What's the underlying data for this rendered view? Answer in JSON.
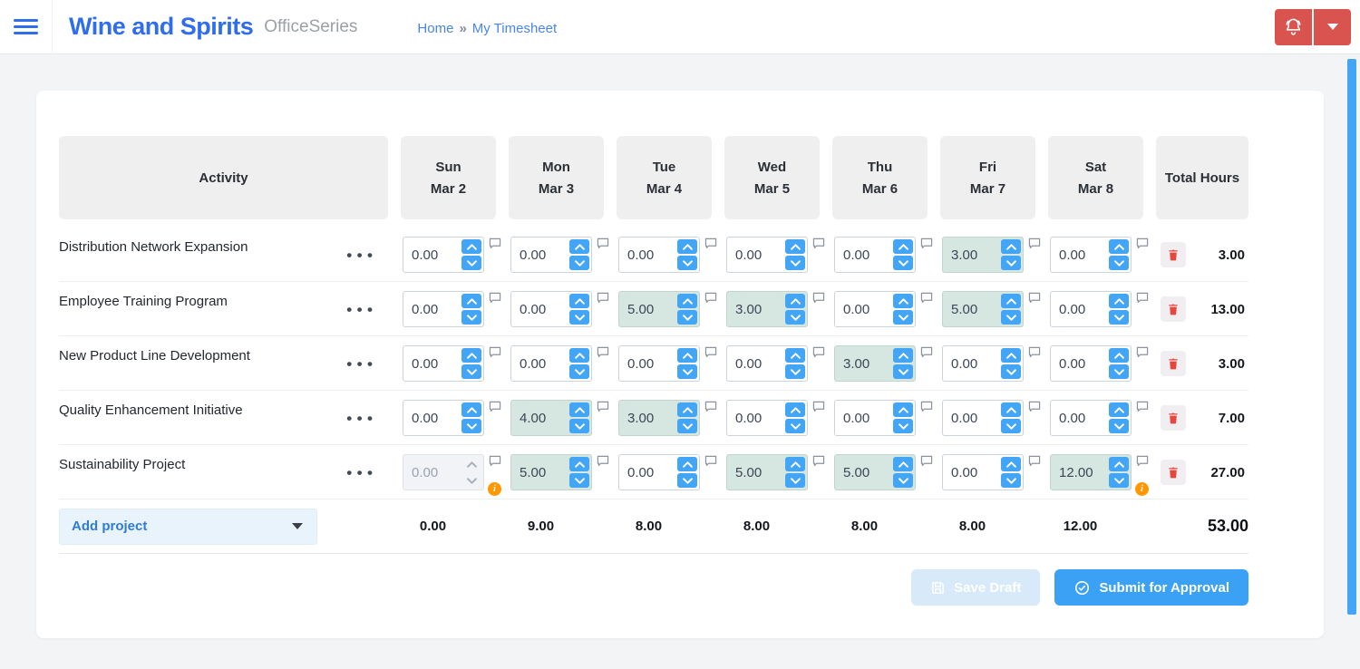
{
  "header": {
    "app_title": "Wine and Spirits",
    "app_subtitle": "OfficeSeries",
    "breadcrumb": {
      "home": "Home",
      "separator": "»",
      "current": "My Timesheet"
    }
  },
  "timesheet": {
    "activity_header": "Activity",
    "total_header": "Total Hours",
    "days": [
      {
        "name": "Sun",
        "date": "Mar 2"
      },
      {
        "name": "Mon",
        "date": "Mar 3"
      },
      {
        "name": "Tue",
        "date": "Mar 4"
      },
      {
        "name": "Wed",
        "date": "Mar 5"
      },
      {
        "name": "Thu",
        "date": "Mar 6"
      },
      {
        "name": "Fri",
        "date": "Mar 7"
      },
      {
        "name": "Sat",
        "date": "Mar 8"
      }
    ],
    "rows": [
      {
        "activity": "Distribution Network Expansion",
        "cells": [
          {
            "value": "0.00"
          },
          {
            "value": "0.00"
          },
          {
            "value": "0.00"
          },
          {
            "value": "0.00"
          },
          {
            "value": "0.00"
          },
          {
            "value": "3.00",
            "highlighted": true
          },
          {
            "value": "0.00"
          }
        ],
        "total": "3.00"
      },
      {
        "activity": "Employee Training Program",
        "cells": [
          {
            "value": "0.00"
          },
          {
            "value": "0.00"
          },
          {
            "value": "5.00",
            "highlighted": true
          },
          {
            "value": "3.00",
            "highlighted": true
          },
          {
            "value": "0.00"
          },
          {
            "value": "5.00",
            "highlighted": true
          },
          {
            "value": "0.00"
          }
        ],
        "total": "13.00"
      },
      {
        "activity": "New Product Line Development",
        "cells": [
          {
            "value": "0.00"
          },
          {
            "value": "0.00"
          },
          {
            "value": "0.00"
          },
          {
            "value": "0.00"
          },
          {
            "value": "3.00",
            "highlighted": true
          },
          {
            "value": "0.00"
          },
          {
            "value": "0.00"
          }
        ],
        "total": "3.00"
      },
      {
        "activity": "Quality Enhancement Initiative",
        "cells": [
          {
            "value": "0.00"
          },
          {
            "value": "4.00",
            "highlighted": true
          },
          {
            "value": "3.00",
            "highlighted": true
          },
          {
            "value": "0.00"
          },
          {
            "value": "0.00"
          },
          {
            "value": "0.00"
          },
          {
            "value": "0.00"
          }
        ],
        "total": "7.00"
      },
      {
        "activity": "Sustainability Project",
        "cells": [
          {
            "value": "0.00",
            "disabled": true,
            "warning": true
          },
          {
            "value": "5.00",
            "highlighted": true
          },
          {
            "value": "0.00"
          },
          {
            "value": "5.00",
            "highlighted": true
          },
          {
            "value": "5.00",
            "highlighted": true
          },
          {
            "value": "0.00"
          },
          {
            "value": "12.00",
            "highlighted": true,
            "warning": true
          }
        ],
        "total": "27.00"
      }
    ],
    "footer": {
      "add_project_label": "Add project",
      "day_totals": [
        "0.00",
        "9.00",
        "8.00",
        "8.00",
        "8.00",
        "8.00",
        "12.00"
      ],
      "grand_total": "53.00"
    },
    "actions": [
      {
        "label": "Save Draft",
        "state": "disabled",
        "icon": "save-icon"
      },
      {
        "label": "Submit for Approval",
        "state": "enabled",
        "icon": "check-circle-icon"
      }
    ]
  },
  "colors": {
    "accent_blue": "#42a5f5",
    "title_blue": "#2f6ded",
    "link_blue": "#4a86e8",
    "danger_red": "#d9534f",
    "trash_red": "#e8453c",
    "highlight_cell": "#d6e6e0",
    "warning_orange": "#ff9800",
    "header_cell_bg": "#efefef",
    "page_bg": "#f2f4f6"
  }
}
